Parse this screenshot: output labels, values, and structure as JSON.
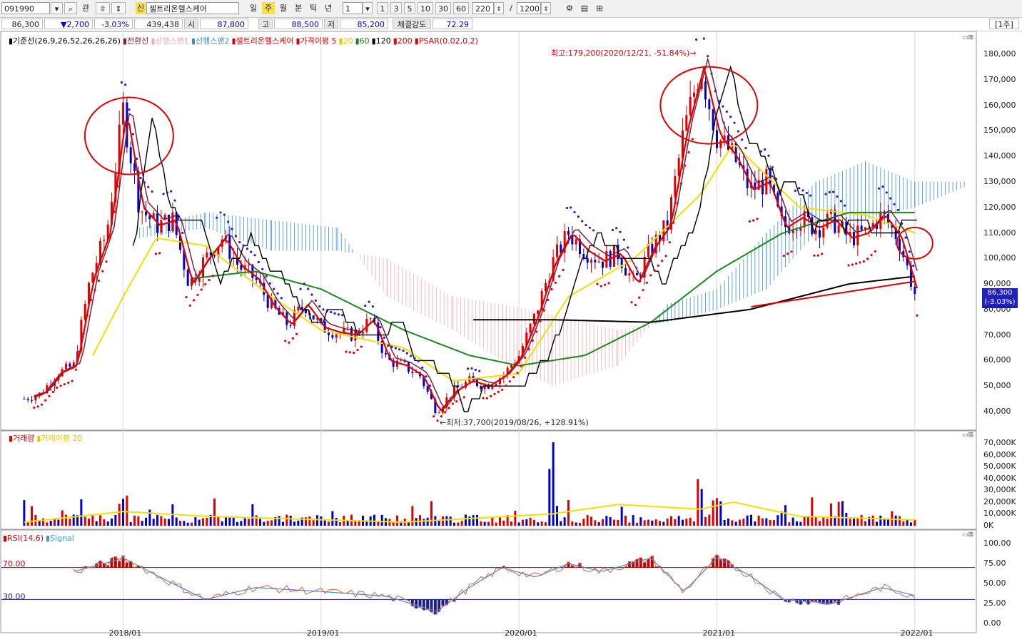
{
  "toolbar": {
    "code": "091990",
    "search_icon": "search-icon",
    "gwan": "관",
    "updown_icon": "updown-arrow-icon",
    "shin": "신",
    "name": "셀트리온헬스케어",
    "periods": [
      "일",
      "주",
      "월",
      "분",
      "틱",
      "년"
    ],
    "active_period": "주",
    "interval": "1",
    "quick": [
      "1",
      "3",
      "5",
      "10",
      "30",
      "60"
    ],
    "bars": "220",
    "slash": "/",
    "total": "1200",
    "tool_icons": [
      "settings-icon",
      "save-icon",
      "chart-tool-icon"
    ]
  },
  "quote": {
    "price": "86,300",
    "change": "▼2,700",
    "pct": "-3.03%",
    "volume": "439,438",
    "open_label": "시",
    "open": "87,800",
    "high_label": "고",
    "high": "88,500",
    "low_label": "저",
    "low": "85,200",
    "strength_label": "체결강도",
    "strength": "72.29",
    "frame": "[1주]"
  },
  "legends": {
    "main": [
      {
        "text": "기준선(26,9,26,52,26,26,26)",
        "color": "#000000"
      },
      {
        "text": "전환선",
        "color": "#7a1f3d"
      },
      {
        "text": "선행스팬1",
        "color": "#f4a6b4"
      },
      {
        "text": "선행스팬2",
        "color": "#3a8fd6"
      },
      {
        "text": "셀트리온헬스케어",
        "color": "#e00000"
      },
      {
        "text": "가격이평 5",
        "color": "#e00000"
      },
      {
        "text": "20",
        "color": "#e6c800"
      },
      {
        "text": "60",
        "color": "#1a8a1a"
      },
      {
        "text": "120",
        "color": "#000000"
      },
      {
        "text": "200",
        "color": "#e00000"
      },
      {
        "text": "PSAR(0.02,0.2)",
        "color": "#e00000"
      }
    ],
    "volume": [
      {
        "text": "거래량",
        "color": "#e00000"
      },
      {
        "text": "거래이평 20",
        "color": "#e6c800"
      }
    ],
    "rsi": [
      {
        "text": "RSI(14,6)",
        "color": "#e00000"
      },
      {
        "text": "Signal",
        "color": "#3aa0c8"
      }
    ]
  },
  "annotations": {
    "high": "최고:179,200(2020/12/21, -51.84%)→",
    "low": "←최저:37,700(2019/08/26, +128.91%)",
    "price_tag": "86,300",
    "price_tag_pct": "(-3.03%)",
    "rsi_upper": "70.00",
    "rsi_lower": "30.00"
  },
  "colors": {
    "up": "#e00000",
    "down": "#0000d0",
    "ma20": "#f2e000",
    "ma60": "#1a8a1a",
    "ma120": "#000000",
    "conversion": "#7a1f3d",
    "span1": "#f4a6b4",
    "span2": "#3a8fd6",
    "psar_up": "#e00000",
    "psar_down": "#2020c0",
    "highlight_circle": "#e00000"
  },
  "chart_data": [
    {
      "type": "candlestick",
      "title": "셀트리온헬스케어 (주봉)",
      "x_ticks": [
        "2018/01",
        "2019/01",
        "2020/01",
        "2021/01",
        "2022/01"
      ],
      "y_ticks": [
        "180,000",
        "170,000",
        "160,000",
        "150,000",
        "140,000",
        "130,000",
        "120,000",
        "110,000",
        "100,000",
        "90,000",
        "80,000",
        "70,000",
        "60,000",
        "50,000",
        "40,000"
      ],
      "ylim": [
        33000,
        183000
      ],
      "xlim": [
        "2017-06",
        "2022-04"
      ],
      "price_path": [
        [
          "2017-07",
          45000
        ],
        [
          "2017-08",
          47000
        ],
        [
          "2017-09",
          55000
        ],
        [
          "2017-10",
          58000
        ],
        [
          "2017-11",
          92000
        ],
        [
          "2017-12",
          110000
        ],
        [
          "2018-01",
          158000
        ],
        [
          "2018-02",
          120000
        ],
        [
          "2018-03",
          113000
        ],
        [
          "2018-04",
          115000
        ],
        [
          "2018-05",
          90000
        ],
        [
          "2018-06",
          100000
        ],
        [
          "2018-07",
          108000
        ],
        [
          "2018-08",
          97000
        ],
        [
          "2018-09",
          92000
        ],
        [
          "2018-10",
          81000
        ],
        [
          "2018-11",
          74000
        ],
        [
          "2018-12",
          82000
        ],
        [
          "2019-01",
          73000
        ],
        [
          "2019-02",
          71000
        ],
        [
          "2019-03",
          70000
        ],
        [
          "2019-04",
          76000
        ],
        [
          "2019-05",
          60000
        ],
        [
          "2019-06",
          58000
        ],
        [
          "2019-07",
          54000
        ],
        [
          "2019-08",
          40000
        ],
        [
          "2019-09",
          48000
        ],
        [
          "2019-10",
          52000
        ],
        [
          "2019-11",
          50000
        ],
        [
          "2019-12",
          54000
        ],
        [
          "2020-01",
          62000
        ],
        [
          "2020-02",
          78000
        ],
        [
          "2020-03",
          98000
        ],
        [
          "2020-04",
          110000
        ],
        [
          "2020-05",
          103000
        ],
        [
          "2020-06",
          99000
        ],
        [
          "2020-07",
          102000
        ],
        [
          "2020-08",
          90000
        ],
        [
          "2020-09",
          104000
        ],
        [
          "2020-10",
          113000
        ],
        [
          "2020-11",
          150000
        ],
        [
          "2020-12",
          175000
        ],
        [
          "2021-01",
          148000
        ],
        [
          "2021-02",
          140000
        ],
        [
          "2021-03",
          127000
        ],
        [
          "2021-04",
          130000
        ],
        [
          "2021-05",
          112000
        ],
        [
          "2021-06",
          116000
        ],
        [
          "2021-07",
          112000
        ],
        [
          "2021-08",
          115000
        ],
        [
          "2021-09",
          108000
        ],
        [
          "2021-10",
          110000
        ],
        [
          "2021-11",
          117000
        ],
        [
          "2021-12",
          108000
        ],
        [
          "2022-01",
          86300
        ]
      ],
      "last": {
        "close": 86300,
        "open": 87800,
        "high": 88500,
        "low": 85200,
        "change": -2700,
        "change_pct": -3.03
      },
      "high_mark": {
        "date": "2020/12/21",
        "value": 179200,
        "pct": -51.84
      },
      "low_mark": {
        "date": "2019/08/26",
        "value": 37700,
        "pct": 128.91
      },
      "series": [
        {
          "name": "20",
          "values_by_month": [
            [
              "2017-11",
              60000
            ],
            [
              "2018-01",
              85000
            ],
            [
              "2018-03",
              108000
            ],
            [
              "2018-06",
              105000
            ],
            [
              "2018-10",
              85000
            ],
            [
              "2019-01",
              72000
            ],
            [
              "2019-06",
              65000
            ],
            [
              "2019-09",
              52000
            ],
            [
              "2020-01",
              55000
            ],
            [
              "2020-04",
              85000
            ],
            [
              "2020-08",
              100000
            ],
            [
              "2020-12",
              125000
            ],
            [
              "2021-02",
              145000
            ],
            [
              "2021-06",
              120000
            ],
            [
              "2021-10",
              117000
            ],
            [
              "2022-01",
              110000
            ]
          ]
        },
        {
          "name": "60",
          "values_by_month": [
            [
              "2018-05",
              92000
            ],
            [
              "2018-09",
              95000
            ],
            [
              "2019-01",
              88000
            ],
            [
              "2019-06",
              72000
            ],
            [
              "2019-10",
              62000
            ],
            [
              "2020-01",
              58000
            ],
            [
              "2020-05",
              62000
            ],
            [
              "2020-09",
              75000
            ],
            [
              "2021-01",
              95000
            ],
            [
              "2021-05",
              110000
            ],
            [
              "2021-09",
              118000
            ],
            [
              "2022-01",
              118000
            ]
          ]
        },
        {
          "name": "120",
          "values_by_month": [
            [
              "2019-10",
              76000
            ],
            [
              "2020-03",
              76000
            ],
            [
              "2020-09",
              75000
            ],
            [
              "2021-03",
              80000
            ],
            [
              "2021-09",
              90000
            ],
            [
              "2022-01",
              93000
            ]
          ]
        },
        {
          "name": "200",
          "values_by_month": [
            [
              "2021-03",
              81000
            ],
            [
              "2021-09",
              87000
            ],
            [
              "2022-01",
              91000
            ]
          ]
        }
      ]
    },
    {
      "type": "bar",
      "title": "거래량",
      "y_ticks": [
        "70,000K",
        "60,000K",
        "50,000K",
        "40,000K",
        "30,000K",
        "20,000K",
        "10,000K",
        "0K"
      ],
      "ylim": [
        0,
        75000
      ],
      "spikes": [
        [
          "2018-01",
          26000
        ],
        [
          "2020-03",
          71000
        ],
        [
          "2020-12",
          48000
        ],
        [
          "2021-01",
          28000
        ]
      ],
      "ma20_level": [
        [
          "2017-07",
          3000
        ],
        [
          "2018-01",
          12000
        ],
        [
          "2018-06",
          8000
        ],
        [
          "2019-06",
          3000
        ],
        [
          "2020-03",
          10000
        ],
        [
          "2020-07",
          18000
        ],
        [
          "2020-12",
          14000
        ],
        [
          "2021-02",
          20000
        ],
        [
          "2021-06",
          8000
        ],
        [
          "2022-01",
          5000
        ]
      ]
    },
    {
      "type": "line",
      "title": "RSI(14,6)",
      "y_ticks": [
        "100.00",
        "75.00",
        "50.00",
        "25.00",
        "0.00"
      ],
      "ylim": [
        0,
        100
      ],
      "levels": [
        70,
        30
      ],
      "rsi_by_month": [
        [
          "2017-10",
          65
        ],
        [
          "2017-12",
          76
        ],
        [
          "2018-01",
          82
        ],
        [
          "2018-04",
          50
        ],
        [
          "2018-06",
          30
        ],
        [
          "2018-09",
          45
        ],
        [
          "2019-01",
          40
        ],
        [
          "2019-05",
          34
        ],
        [
          "2019-08",
          15
        ],
        [
          "2019-10",
          45
        ],
        [
          "2019-12",
          70
        ],
        [
          "2020-02",
          58
        ],
        [
          "2020-04",
          75
        ],
        [
          "2020-06",
          65
        ],
        [
          "2020-09",
          82
        ],
        [
          "2020-11",
          40
        ],
        [
          "2021-01",
          82
        ],
        [
          "2021-03",
          60
        ],
        [
          "2021-05",
          30
        ],
        [
          "2021-08",
          25
        ],
        [
          "2021-11",
          45
        ],
        [
          "2022-01",
          35
        ]
      ]
    }
  ]
}
